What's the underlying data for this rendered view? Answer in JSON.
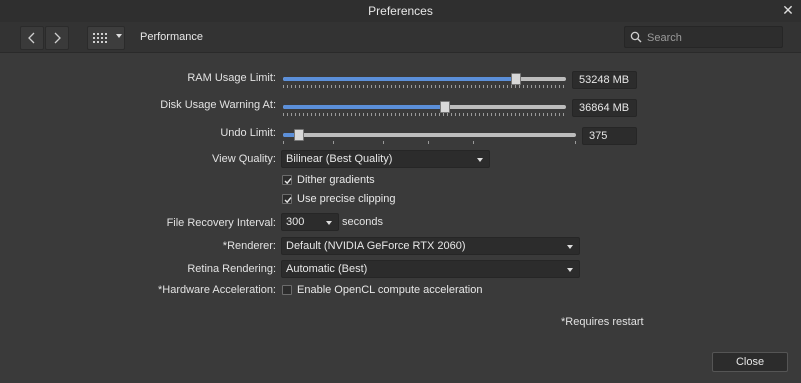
{
  "window": {
    "title": "Preferences"
  },
  "toolbar": {
    "section": "Performance",
    "search_placeholder": "Search"
  },
  "ram": {
    "label": "RAM Usage Limit:",
    "value": "53248 MB",
    "level": 0.82
  },
  "disk": {
    "label": "Disk Usage Warning At:",
    "value": "36864 MB",
    "level": 0.57
  },
  "undo": {
    "label": "Undo Limit:",
    "value": "375",
    "level": 0.05
  },
  "view_quality": {
    "label": "View Quality:",
    "value": "Bilinear (Best Quality)"
  },
  "dither": {
    "label": "Dither gradients",
    "checked": true
  },
  "clipping": {
    "label": "Use precise clipping",
    "checked": true
  },
  "recovery": {
    "label": "File Recovery Interval:",
    "value": "300",
    "unit": "seconds"
  },
  "renderer": {
    "label": "*Renderer:",
    "value": "Default (NVIDIA GeForce RTX 2060)"
  },
  "retina": {
    "label": "Retina Rendering:",
    "value": "Automatic (Best)"
  },
  "hw_accel": {
    "label": "*Hardware Acceleration:",
    "option": "Enable OpenCL compute acceleration",
    "checked": false
  },
  "footer": {
    "note": "*Requires restart",
    "close_label": "Close"
  },
  "colors": {
    "accent": "#5b8fd9",
    "background": "#3a3a3a",
    "field": "#2c2c2c"
  }
}
